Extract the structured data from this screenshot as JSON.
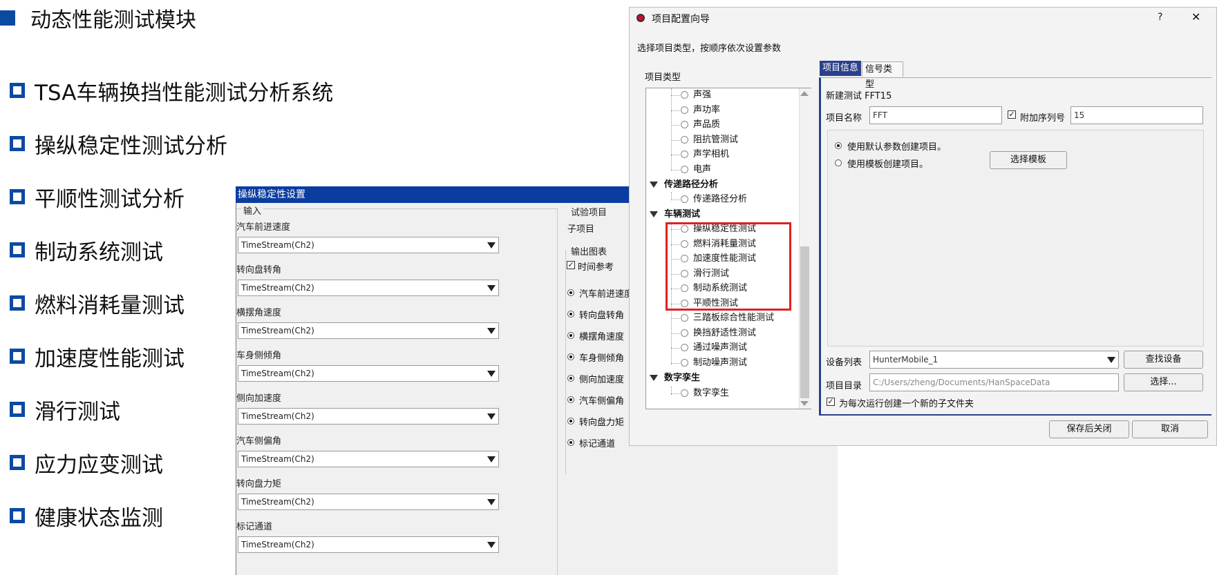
{
  "slide": {
    "title": "动态性能测试模块",
    "bullets": [
      "TSA车辆换挡性能测试分析系统",
      "操纵稳定性测试分析",
      "平顺性测试分析",
      "制动系统测试",
      "燃料消耗量测试",
      "加速度性能测试",
      "滑行测试",
      "应力应变测试",
      "健康状态监测"
    ]
  },
  "handling": {
    "title": "操纵稳定性设置",
    "input_group": "输入",
    "fields": [
      {
        "label": "汽车前进速度",
        "value": "TimeStream(Ch2)"
      },
      {
        "label": "转向盘转角",
        "value": "TimeStream(Ch2)"
      },
      {
        "label": "横摆角速度",
        "value": "TimeStream(Ch2)"
      },
      {
        "label": "车身侧倾角",
        "value": "TimeStream(Ch2)"
      },
      {
        "label": "侧向加速度",
        "value": "TimeStream(Ch2)"
      },
      {
        "label": "汽车侧偏角",
        "value": "TimeStream(Ch2)"
      },
      {
        "label": "转向盘力矩",
        "value": "TimeStream(Ch2)"
      },
      {
        "label": "标记通道",
        "value": "TimeStream(Ch2)"
      }
    ],
    "test_group": "试验项目",
    "sub_item": "子项目",
    "output_group": "输出图表",
    "time_ref": "时间参考",
    "outputs": [
      "汽车前进速度",
      "转向盘转角",
      "横摆角速度",
      "车身侧倾角",
      "侧向加速度",
      "汽车侧偏角",
      "转向盘力矩",
      "标记通道"
    ]
  },
  "dialog": {
    "title": "项目配置向导",
    "help": "?",
    "close": "✕",
    "instruction": "选择项目类型，按顺序依次设置参数",
    "tree_label": "项目类型",
    "tree": {
      "acoustic_items": [
        "声强",
        "声功率",
        "声品质",
        "阻抗管测试",
        "声学相机",
        "电声"
      ],
      "cat_path": "传递路径分析",
      "path_items": [
        "传递路径分析"
      ],
      "cat_vehicle": "车辆测试",
      "vehicle_items": [
        "操纵稳定性测试",
        "燃料消耗量测试",
        "加速度性能测试",
        "滑行测试",
        "制动系统测试",
        "平顺性测试",
        "三踏板综合性能测试",
        "换挡舒适性测试",
        "通过噪声测试",
        "制动噪声测试"
      ],
      "cat_digital": "数字孪生",
      "digital_items": [
        "数字孪生"
      ]
    },
    "tabs": [
      "项目信息",
      "信号类型"
    ],
    "new_test": "新建测试 FFT15",
    "name_label": "项目名称",
    "name_value": "FFT",
    "serial_label": "附加序列号",
    "serial_value": "15",
    "opt_default": "使用默认参数创建项目。",
    "opt_template": "使用模板创建项目。",
    "select_template": "选择模板",
    "device_label": "设备列表",
    "device_value": "HunterMobile_1",
    "find_device": "查找设备",
    "dir_label": "项目目录",
    "dir_value": "C:/Users/zheng/Documents/HanSpaceData",
    "browse": "选择...",
    "subfolder": "为每次运行创建一个新的子文件夹",
    "save_close": "保存后关闭",
    "cancel": "取消"
  }
}
